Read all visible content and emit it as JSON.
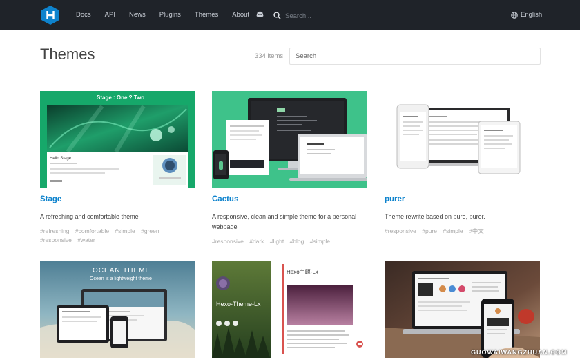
{
  "nav": {
    "links": [
      "Docs",
      "API",
      "News",
      "Plugins",
      "Themes",
      "About"
    ],
    "search_placeholder": "Search...",
    "language": "English"
  },
  "header": {
    "title": "Themes",
    "count": "334 items",
    "search_placeholder": "Search"
  },
  "themes": [
    {
      "name": "Stage",
      "description": "A refreshing and comfortable theme",
      "tags": [
        "#refreshing",
        "#comfortable",
        "#simple",
        "#green",
        "#responsive",
        "#water"
      ],
      "thumb": {
        "banner": "Stage : One ? Two",
        "post_title": "Hello Stage"
      }
    },
    {
      "name": "Cactus",
      "description": "A responsive, clean and simple theme for a personal webpage",
      "tags": [
        "#responsive",
        "#dark",
        "#light",
        "#blog",
        "#simple"
      ]
    },
    {
      "name": "purer",
      "description": "Theme rewrite based on pure, purer.",
      "tags": [
        "#responsive",
        "#pure",
        "#simple",
        "#中文"
      ]
    },
    {
      "thumb": {
        "title": "OCEAN THEME",
        "subtitle": "Ocean is a lightweight theme"
      }
    },
    {
      "thumb": {
        "title": "Hexo-Theme-Lx",
        "post_title": "Hexo主题-Lx"
      }
    },
    {
      "thumb": {}
    }
  ],
  "watermark": "GUOWAIWANGZHUAN.COM",
  "colors": {
    "nav_bg": "#1f2329",
    "link": "#0e83cd",
    "logo": "#0e83cd",
    "stage_green": "#16a86a",
    "cactus_green": "#3ec28a"
  }
}
